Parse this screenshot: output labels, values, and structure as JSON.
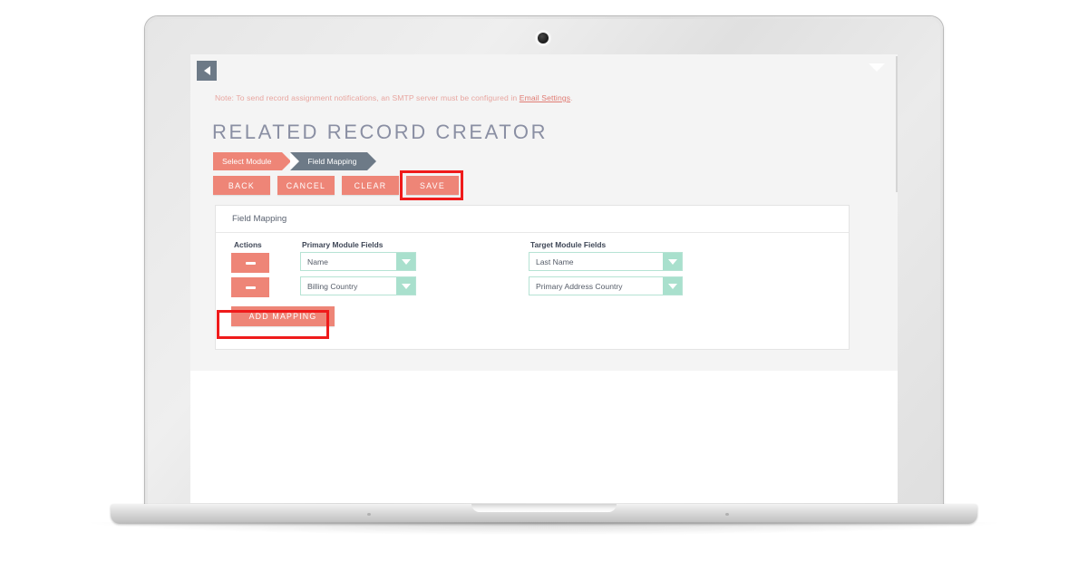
{
  "app": {
    "collapse_icon": "triangle-left-icon",
    "corner_icon": "triangle-down-icon",
    "note": {
      "prefix": "Note: To send record assignment notifications, an SMTP server must be configured in ",
      "link": "Email Settings",
      "suffix": "."
    },
    "page_title": "RELATED RECORD CREATOR",
    "breadcrumb": [
      {
        "label": "Select Module",
        "state": "completed",
        "color": "#ee8577"
      },
      {
        "label": "Field Mapping",
        "state": "current",
        "color": "#6d7a87"
      }
    ],
    "toolbar": {
      "back_label": "BACK",
      "cancel_label": "CANCEL",
      "clear_label": "CLEAR",
      "save_label": "SAVE"
    },
    "card": {
      "title": "Field Mapping",
      "headers": {
        "actions": "Actions",
        "primary": "Primary Module Fields",
        "target": "Target Module Fields"
      },
      "rows": [
        {
          "action_icon": "minus-icon",
          "primary_value": "Name",
          "target_value": "Last Name"
        },
        {
          "action_icon": "minus-icon",
          "primary_value": "Billing Country",
          "target_value": "Primary Address Country"
        }
      ],
      "add_mapping_label": "ADD MAPPING"
    },
    "highlights": [
      {
        "target": "save-button",
        "color": "#ef1b1b"
      },
      {
        "target": "add-mapping-button",
        "color": "#ef1b1b"
      }
    ],
    "colors": {
      "accent_coral": "#ee8577",
      "slate": "#6d7a87",
      "mint": "#a9e0cd",
      "mint_border": "#b6e3d4",
      "highlight_red": "#ef1b1b",
      "title_grey": "#8a8fa3",
      "note_pink": "#e8a6a0",
      "app_bg": "#f4f4f4"
    }
  }
}
